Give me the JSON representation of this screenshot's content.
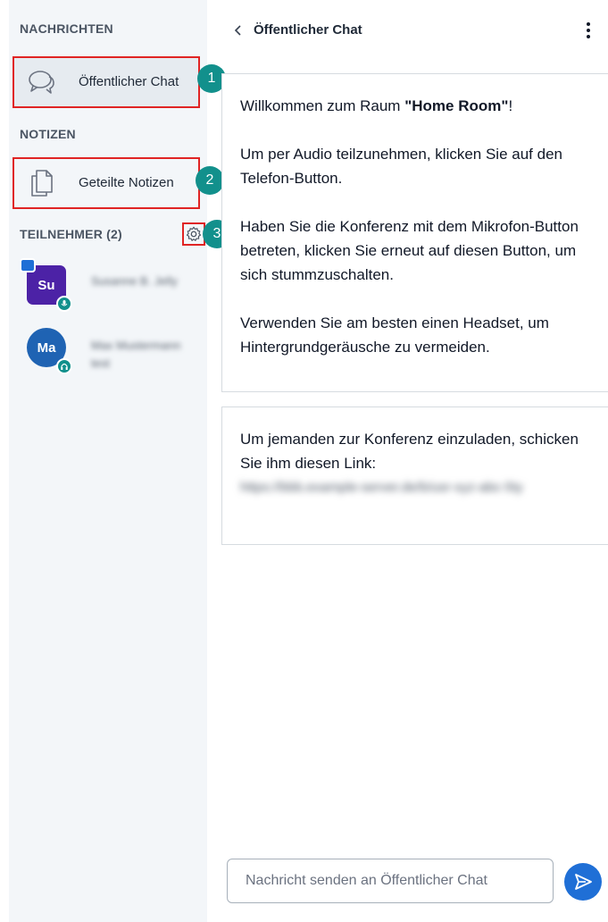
{
  "sidebar": {
    "messages_title": "NACHRICHTEN",
    "public_chat_label": "Öffentlicher Chat",
    "notes_title": "NOTIZEN",
    "shared_notes_label": "Geteilte Notizen",
    "participants_title": "TEILNEHMER (2)",
    "participants": [
      {
        "initials": "Su",
        "name": "Susanne B. Jelly",
        "audio": "microphone",
        "presenter": true
      },
      {
        "initials": "Ma",
        "name": "Max Mustermann test",
        "audio": "headphones",
        "presenter": false
      }
    ]
  },
  "callouts": [
    "1",
    "2",
    "3"
  ],
  "chat": {
    "title": "Öffentlicher Chat",
    "welcome": {
      "line1_pre": "Willkommen zum Raum ",
      "line1_bold": "\"Home Room\"",
      "line1_post": "!",
      "para2": "Um per Audio teilzunehmen, klicken Sie auf den Telefon-Button.",
      "para3": "Haben Sie die Konferenz mit dem Mikrofon-Button betreten, klicken Sie erneut auf diesen Button, um sich stummzuschalten.",
      "para4": "Verwenden Sie am besten einen Headset, um Hintergrundgeräusche zu vermeiden."
    },
    "invite": {
      "text": "Um jemanden zur Konferenz einzuladen, schicken Sie ihm diesen Link:",
      "link": "https://bbb.example-server.de/b/usr-xyz-abc-5ty"
    },
    "input_placeholder": "Nachricht senden an Öffentlicher Chat"
  },
  "colors": {
    "accent": "#12908c",
    "highlight_border": "#e02424",
    "send_button": "#1f6fd6",
    "presenter_avatar": "#4c22a6",
    "viewer_avatar": "#1f63b3"
  }
}
